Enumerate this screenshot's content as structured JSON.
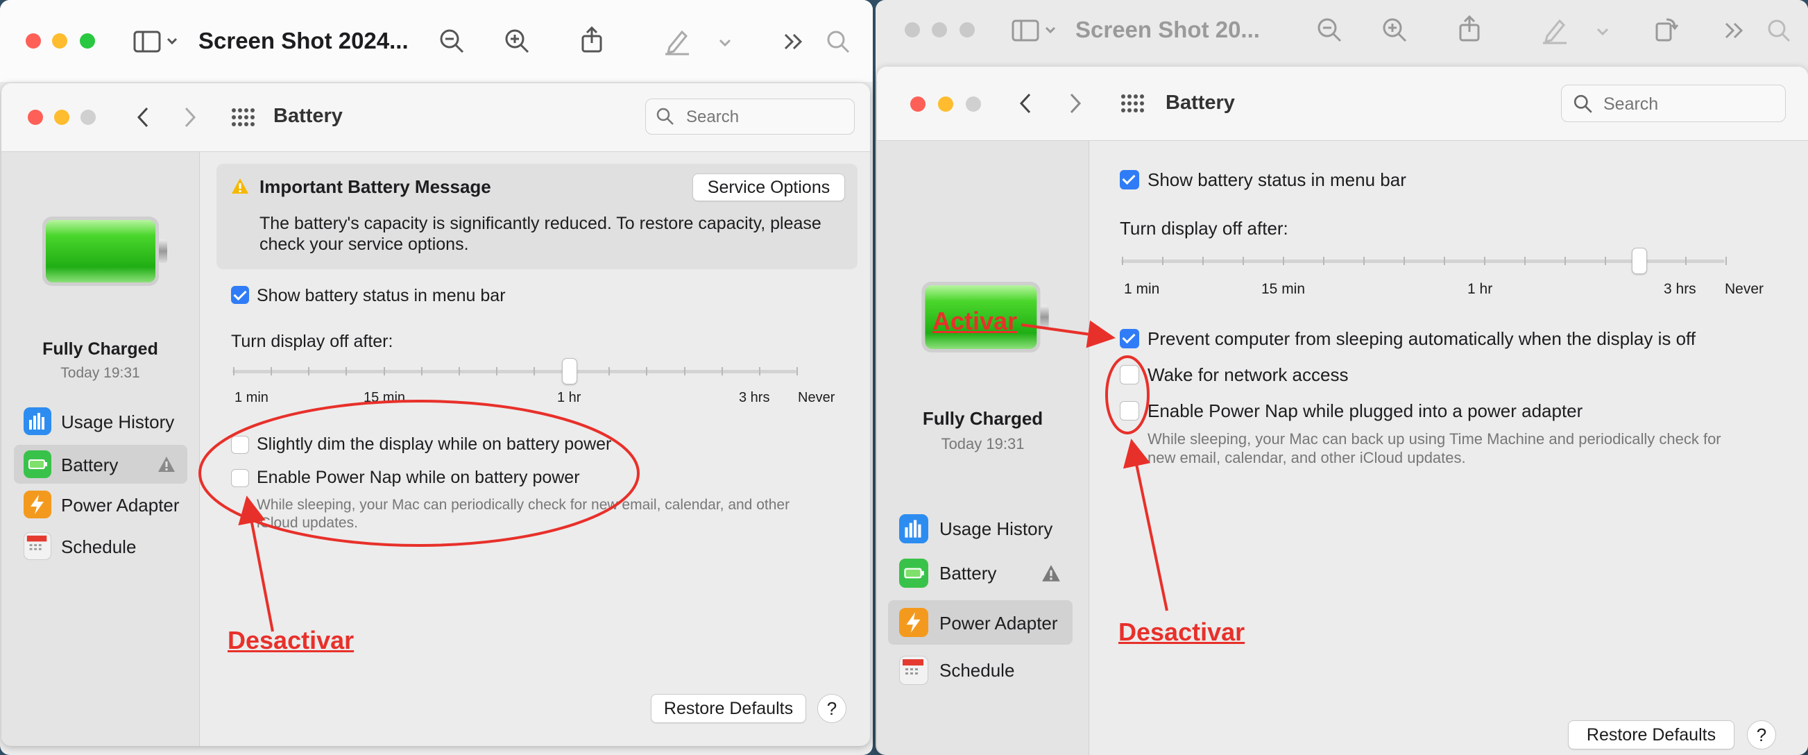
{
  "left_preview": {
    "title": "Screen Shot 2024..."
  },
  "right_preview": {
    "title": "Screen Shot 20..."
  },
  "left_prefs": {
    "pane_title": "Battery",
    "search_placeholder": "Search",
    "status": {
      "label": "Fully Charged",
      "time": "Today 19:31"
    },
    "sidebar": [
      {
        "label": "Usage History"
      },
      {
        "label": "Battery"
      },
      {
        "label": "Power Adapter"
      },
      {
        "label": "Schedule"
      }
    ],
    "message": {
      "title": "Important Battery Message",
      "button": "Service Options",
      "body_line1": "The battery's capacity is significantly reduced. To restore capacity, please",
      "body_line2": "check your service options."
    },
    "show_status": "Show battery status in menu bar",
    "display_off_label": "Turn display off after:",
    "slider_labels": [
      "1 min",
      "15 min",
      "1 hr",
      "3 hrs",
      "Never"
    ],
    "dim_label": "Slightly dim the display while on battery power",
    "power_nap_label": "Enable Power Nap while on battery power",
    "power_nap_desc1": "While sleeping, your Mac can periodically check for new email, calendar, and other",
    "power_nap_desc2": "iCloud updates.",
    "restore": "Restore Defaults",
    "help": "?"
  },
  "right_prefs": {
    "pane_title": "Battery",
    "search_placeholder": "Search",
    "status": {
      "label": "Fully Charged",
      "time": "Today 19:31"
    },
    "sidebar": [
      {
        "label": "Usage History"
      },
      {
        "label": "Battery"
      },
      {
        "label": "Power Adapter"
      },
      {
        "label": "Schedule"
      }
    ],
    "show_status": "Show battery status in menu bar",
    "display_off_label": "Turn display off after:",
    "slider_labels": [
      "1 min",
      "15 min",
      "1 hr",
      "3 hrs",
      "Never"
    ],
    "prevent_sleep": "Prevent computer from sleeping automatically when the display is off",
    "wake_network": "Wake for network access",
    "power_nap_label": "Enable Power Nap while plugged into a power adapter",
    "power_nap_desc1": "While sleeping, your Mac can back up using Time Machine and periodically check for",
    "power_nap_desc2": "new email, calendar, and other iCloud updates.",
    "restore": "Restore Defaults",
    "help": "?"
  },
  "annotations": {
    "left_desactivar": "Desactivar",
    "right_activar": "Activar",
    "right_desactivar": "Desactivar"
  },
  "colors": {
    "accent": "#2f7cf6",
    "annotation": "#e8302a",
    "close": "#fe5f57",
    "minimize": "#febc2e",
    "zoom": "#28c840"
  }
}
